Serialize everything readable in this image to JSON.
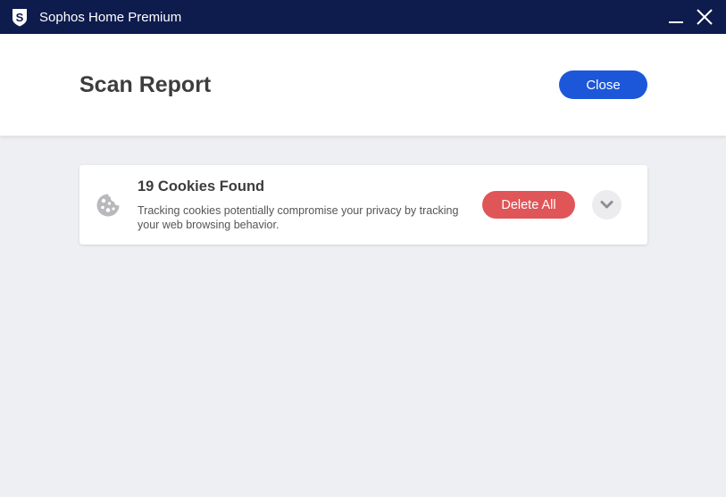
{
  "window": {
    "title": "Sophos Home Premium",
    "logo_icon": "sophos-shield-s-icon",
    "minimize_icon": "minimize-icon",
    "close_icon": "close-icon"
  },
  "header": {
    "title": "Scan Report",
    "close_label": "Close"
  },
  "findings": [
    {
      "icon": "cookie-icon",
      "title": "19 Cookies Found",
      "description": "Tracking cookies potentially compromise your privacy by tracking your web browsing behavior.",
      "action_label": "Delete All",
      "expand_icon": "chevron-down-icon"
    }
  ],
  "colors": {
    "titlebar": "#0e1b4d",
    "primary_button": "#1c57d9",
    "danger_button": "#e05557",
    "background": "#eeeff2"
  }
}
